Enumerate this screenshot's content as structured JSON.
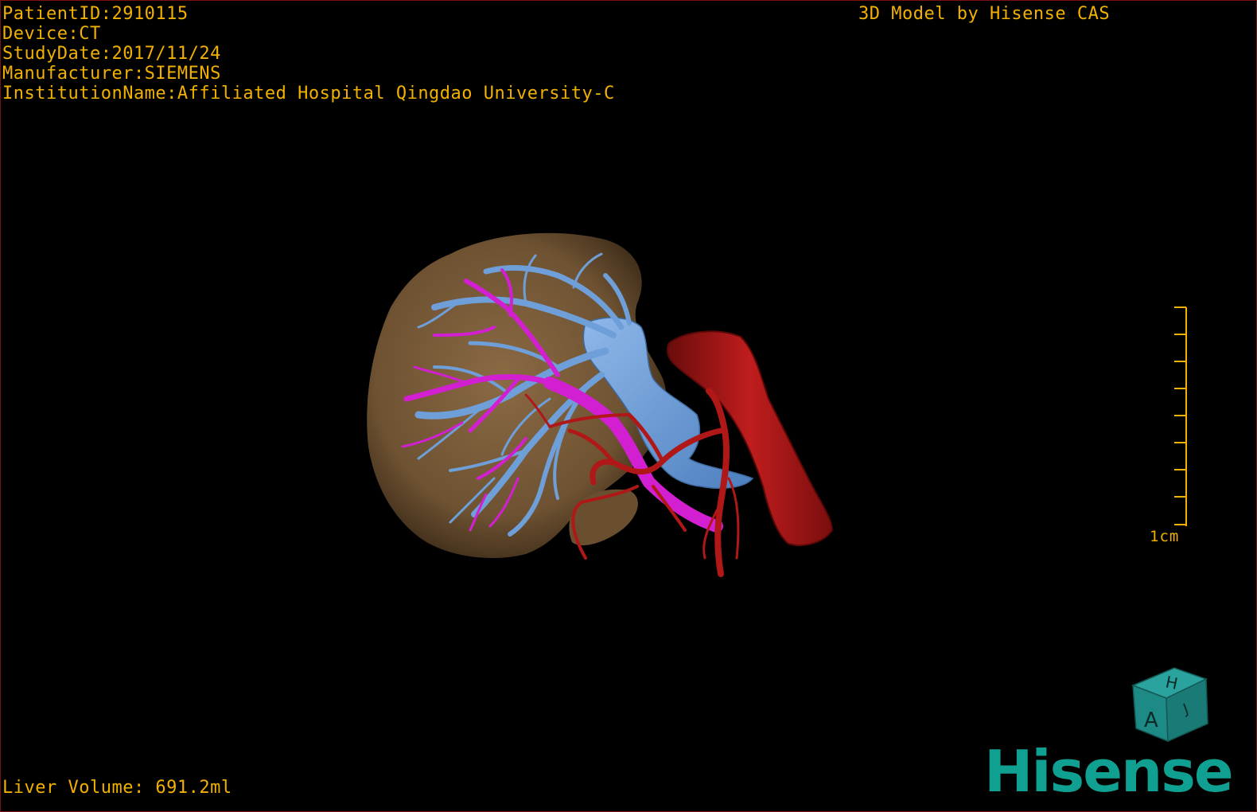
{
  "header": {
    "patient_id": "PatientID:2910115",
    "device": "Device:CT",
    "study_date": "StudyDate:2017/11/24",
    "manufacturer": "Manufacturer:SIEMENS",
    "institution": "InstitutionName:Affiliated Hospital Qingdao University-C"
  },
  "credit": "3D Model by Hisense CAS",
  "footer": {
    "liver_volume": "Liver Volume: 691.2ml"
  },
  "scale_bar": {
    "label": "1cm"
  },
  "orientation_cube": {
    "face_top": "H",
    "face_front": "A",
    "face_side": "J"
  },
  "logo": {
    "text": "Hisense"
  },
  "colors": {
    "text": "#f2b100",
    "liver": "#7a5c3a",
    "hepatic_vein": "#6f9fd8",
    "portal_vein": "#d21fd2",
    "artery": "#b01818",
    "logo": "#10a091",
    "cube": "#1e8a86",
    "border": "#7a1010"
  }
}
